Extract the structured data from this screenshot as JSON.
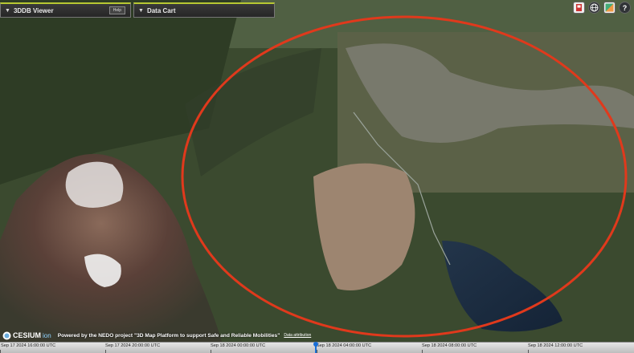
{
  "panels": {
    "viewer_title": "3DDB Viewer",
    "help_label": "Help",
    "cart_title": "Data Cart"
  },
  "toolbar": {
    "help_glyph": "?",
    "icons": [
      "geocoder-icon",
      "globe-icon",
      "imagery-layers-icon",
      "help-icon"
    ]
  },
  "footer": {
    "brand": "CESIUM",
    "brand_sub": "ion",
    "powered_by": "Powered by the NEDO project \"3D Map Platform to support Safe and Reliable Mobilities\"",
    "attribution": "Data attribution"
  },
  "timeline": {
    "ticks": [
      "Sep 17 2024 16:00:00 UTC",
      "Sep 17 2024 20:00:00 UTC",
      "Sep 18 2024 00:00:00 UTC",
      "Sep 18 2024 04:00:00 UTC",
      "Sep 18 2024 08:00:00 UTC",
      "Sep 18 2024 12:00:00 UTC"
    ]
  },
  "colors": {
    "panel_accent": "#b8c832",
    "annotation_circle": "#e0391c",
    "timeline_needle": "#1a6fd6"
  }
}
